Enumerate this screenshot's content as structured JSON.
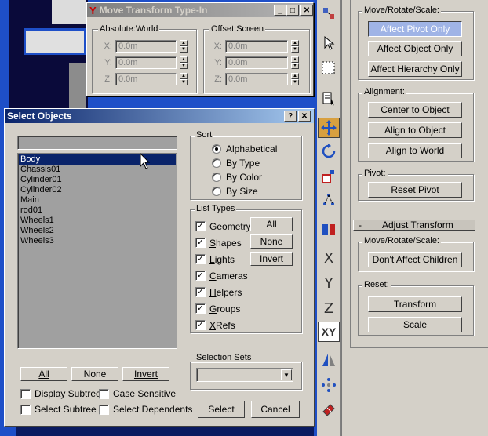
{
  "move_window": {
    "title": "Move Transform Type-In",
    "absolute_label": "Absolute:World",
    "offset_label": "Offset:Screen",
    "axes": [
      "X:",
      "Y:",
      "Z:"
    ],
    "absolute_values": [
      "0.0m",
      "0.0m",
      "0.0m"
    ],
    "offset_values": [
      "0.0m",
      "0.0m",
      "0.0m"
    ]
  },
  "select_dialog": {
    "title": "Select Objects",
    "search_value": "",
    "objects": [
      "Body",
      "Chassis01",
      "Cylinder01",
      "Cylinder02",
      "Main",
      "rod01",
      "Wheels1",
      "Wheels2",
      "Wheels3"
    ],
    "selected_index": 0,
    "sort_label": "Sort",
    "sort_options": [
      "Alphabetical",
      "By Type",
      "By Color",
      "By Size"
    ],
    "sort_selected": 0,
    "list_types_label": "List Types",
    "list_types": [
      {
        "first": "G",
        "rest": "eometry"
      },
      {
        "first": "S",
        "rest": "hapes"
      },
      {
        "first": "L",
        "rest": "ights"
      },
      {
        "first": "C",
        "rest": "ameras"
      },
      {
        "first": "H",
        "rest": "elpers"
      },
      {
        "first": "G",
        "rest": "roups"
      },
      {
        "first": "X",
        "rest": "Refs"
      }
    ],
    "type_buttons": [
      "All",
      "None",
      "Invert"
    ],
    "bottom_buttons": {
      "all": "All",
      "none": "None",
      "invert": "Invert"
    },
    "options": {
      "display_subtree": "Display Subtree",
      "case_sensitive": "Case Sensitive",
      "select_subtree": "Select Subtree",
      "select_dependents": "Select Dependents"
    },
    "selection_sets_label": "Selection Sets",
    "selection_set_value": "",
    "select_button": "Select",
    "cancel_button": "Cancel"
  },
  "toolbar": {
    "icons": [
      "select-arrow-icon",
      "select-region-icon",
      "select-by-name-icon",
      "move-icon",
      "rotate-icon",
      "scale-icon",
      "link-icon",
      "mirror-icon",
      "x-axis-icon",
      "y-axis-icon",
      "z-axis-icon",
      "xy-plane-icon",
      "align-icon",
      "array-icon",
      "eraser-icon"
    ],
    "x_label": "X",
    "y_label": "Y",
    "z_label": "Z",
    "xy_label": "XY"
  },
  "right_panel": {
    "move_rotate_scale_label": "Move/Rotate/Scale:",
    "affect_pivot_only": "Affect Pivot Only",
    "affect_object_only": "Affect Object Only",
    "affect_hierarchy_only": "Affect Hierarchy Only",
    "alignment_label": "Alignment:",
    "center_to_object": "Center to Object",
    "align_to_object": "Align to Object",
    "align_to_world": "Align to World",
    "pivot_label": "Pivot:",
    "reset_pivot": "Reset Pivot",
    "rollout_toggle": "-",
    "adjust_transform_title": "Adjust Transform",
    "mrs_label2": "Move/Rotate/Scale:",
    "dont_affect_children": "Don't Affect Children",
    "reset_label": "Reset:",
    "transform": "Transform",
    "scale": "Scale"
  },
  "colors": {
    "accent_selected": "#0a246a",
    "active_tool": "#d8a040",
    "affect_pivot_bg": "#a0b4e6"
  }
}
